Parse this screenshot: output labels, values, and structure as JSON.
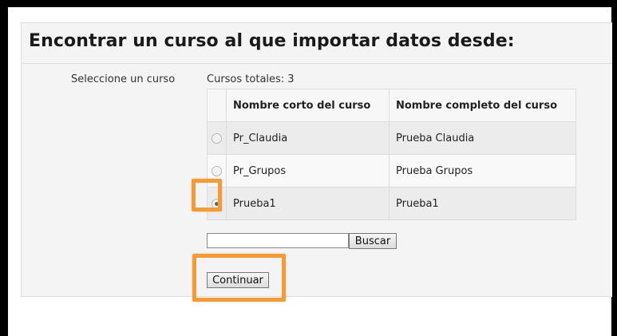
{
  "page": {
    "title": "Encontrar un curso al que importar datos desde:"
  },
  "form": {
    "select_label": "Seleccione un curso",
    "total_courses": "Cursos totales: 3",
    "columns": [
      "",
      "Nombre corto del curso",
      "Nombre completo del curso"
    ],
    "courses": [
      {
        "short": "Pr_Claudia",
        "full": "Prueba Claudia",
        "selected": false
      },
      {
        "short": "Pr_Grupos",
        "full": "Prueba Grupos",
        "selected": false
      },
      {
        "short": "Prueba1",
        "full": "Prueba1",
        "selected": true
      }
    ],
    "search": {
      "value": "",
      "button_label": "Buscar"
    },
    "continue_label": "Continuar"
  },
  "colors": {
    "highlight": "#f29b38",
    "panel_bg": "#f4f4f4",
    "border": "#dcdcdc"
  }
}
